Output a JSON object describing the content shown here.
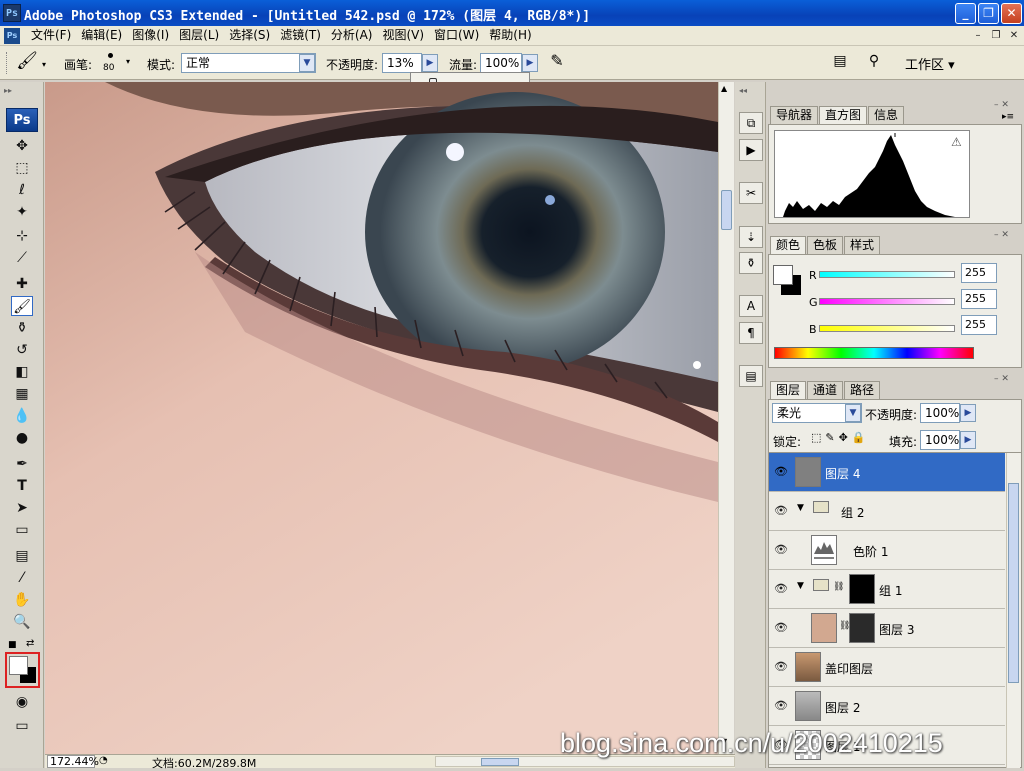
{
  "window": {
    "title": "Adobe Photoshop CS3 Extended - [Untitled 542.psd @ 172% (图层 4, RGB/8*)]",
    "app_icon": "Ps"
  },
  "menu": {
    "items": [
      "文件(F)",
      "编辑(E)",
      "图像(I)",
      "图层(L)",
      "选择(S)",
      "滤镜(T)",
      "分析(A)",
      "视图(V)",
      "窗口(W)",
      "帮助(H)"
    ]
  },
  "options": {
    "brush_label": "画笔:",
    "brush_size": "80",
    "mode_label": "模式:",
    "mode_value": "正常",
    "opacity_label": "不透明度:",
    "opacity_value": "13%",
    "flow_label": "流量:",
    "flow_value": "100%",
    "workspace_label": "工作区 ▾",
    "opacity_slider_value": 0.13
  },
  "toolbox": {
    "logo": "Ps"
  },
  "status": {
    "zoom": "172.44%",
    "doc_size": "文档:60.2M/289.8M"
  },
  "panel_top": {
    "tabs": [
      "导航器",
      "直方图",
      "信息"
    ],
    "active_tab": "直方图"
  },
  "panel_color": {
    "tabs": [
      "颜色",
      "色板",
      "样式"
    ],
    "channels": [
      {
        "label": "R",
        "value": "255"
      },
      {
        "label": "G",
        "value": "255"
      },
      {
        "label": "B",
        "value": "255"
      }
    ]
  },
  "panel_layers": {
    "tabs": [
      "图层",
      "通道",
      "路径"
    ],
    "blend_mode": "柔光",
    "opacity_label": "不透明度:",
    "opacity_value": "100%",
    "lock_label": "锁定:",
    "fill_label": "填充:",
    "fill_value": "100%",
    "layers": [
      {
        "name": "图层 4",
        "selected": true
      },
      {
        "name": "组 2",
        "type": "group"
      },
      {
        "name": "色阶 1",
        "type": "adjustment"
      },
      {
        "name": "组 1",
        "type": "group"
      },
      {
        "name": "图层 3"
      },
      {
        "name": "盖印图层"
      },
      {
        "name": "图层 2"
      },
      {
        "name": "图层 1"
      }
    ]
  },
  "watermark": "blog.sina.com.cn/u/2002410215",
  "colors": {
    "titlebar": "#0842b8",
    "selection": "#316ac5",
    "skin": "#d2a898"
  }
}
